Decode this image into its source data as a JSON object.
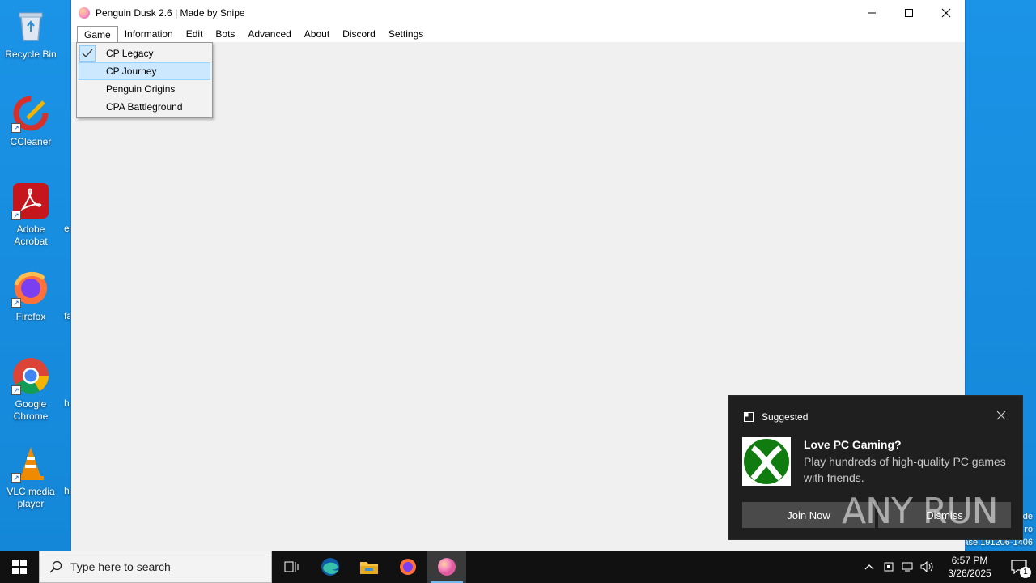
{
  "desktop": {
    "icons": [
      {
        "label": "Recycle Bin",
        "icon": "recycle-bin-icon"
      },
      {
        "label": "CCleaner",
        "icon": "ccleaner-icon"
      },
      {
        "label": "Adobe Acrobat",
        "icon": "adobe-acrobat-icon"
      },
      {
        "label": "Firefox",
        "icon": "firefox-icon"
      },
      {
        "label": "Google Chrome",
        "icon": "chrome-icon"
      },
      {
        "label": "VLC media player",
        "icon": "vlc-icon"
      }
    ],
    "peek_texts": [
      "er",
      "fa",
      "h",
      "hi"
    ],
    "side_texts": [
      "de",
      "ro",
      "ase.191206-1406"
    ]
  },
  "window": {
    "title": "Penguin Dusk 2.6 | Made by Snipe",
    "menu": [
      "Game",
      "Information",
      "Edit",
      "Bots",
      "Advanced",
      "About",
      "Discord",
      "Settings"
    ],
    "open_menu": "Game",
    "dropdown": [
      {
        "label": "CP Legacy",
        "checked": true
      },
      {
        "label": "CP Journey",
        "highlighted": true
      },
      {
        "label": "Penguin Origins"
      },
      {
        "label": "CPA Battleground"
      }
    ]
  },
  "taskbar": {
    "search_placeholder": "Type here to search",
    "apps": [
      "task-view-icon",
      "edge-icon",
      "file-explorer-icon",
      "firefox-icon",
      "penguin-dusk-icon"
    ],
    "active_app": "penguin-dusk-icon",
    "time": "6:57 PM",
    "date": "3/26/2025",
    "notification_count": "1"
  },
  "toast": {
    "header": "Suggested",
    "title": "Love PC Gaming?",
    "body": "Play hundreds of high-quality PC games with friends.",
    "primary_button": "Join Now",
    "secondary_button": "Dismiss"
  },
  "watermark": "ANY RUN",
  "colors": {
    "desktop": "#1a8ee0",
    "menu_highlight": "#cce8ff",
    "toast_bg": "#1f1f1f",
    "xbox_green": "#107c10"
  }
}
